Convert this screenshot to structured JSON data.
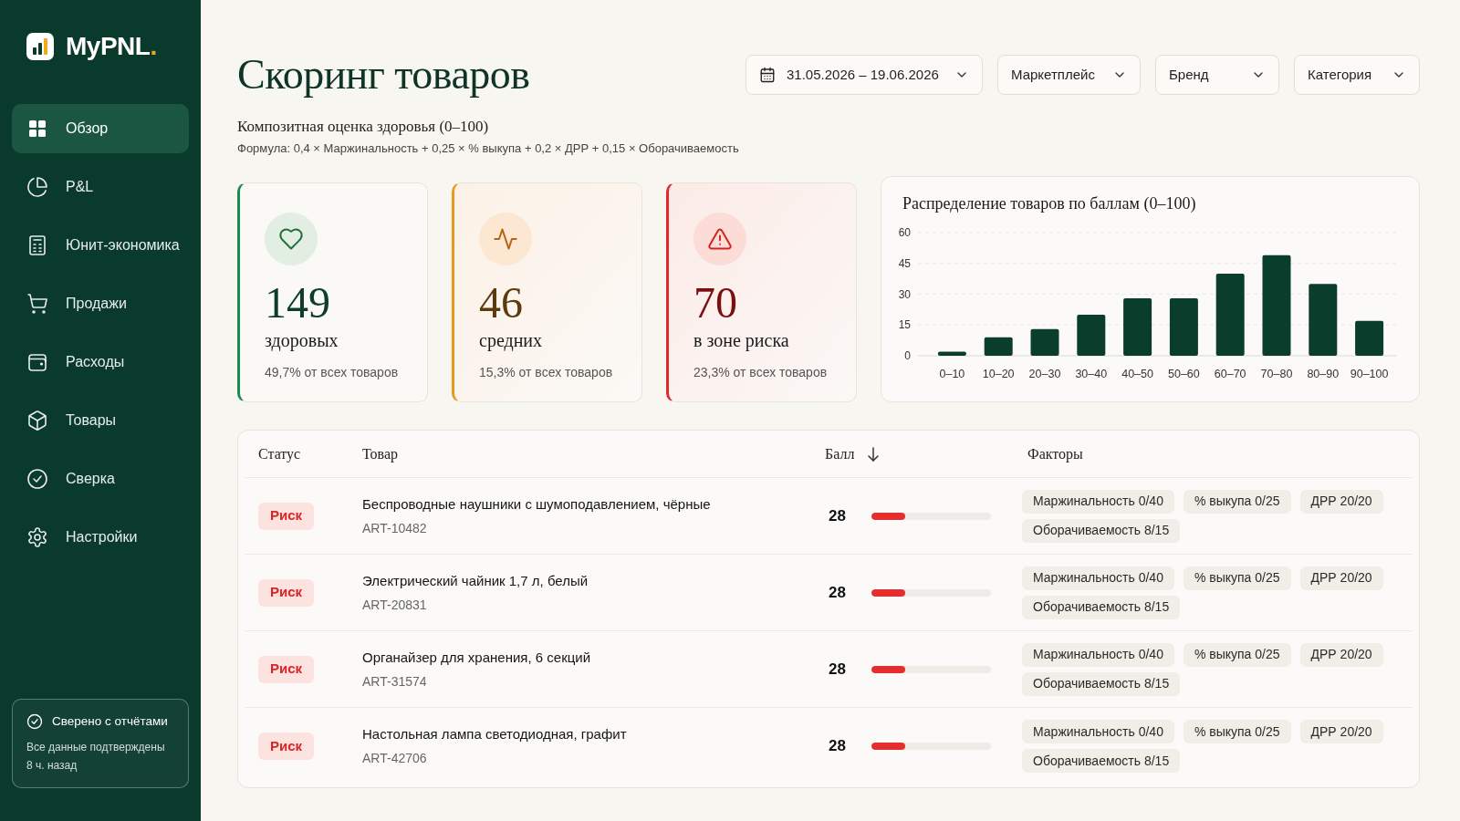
{
  "sidebar": {
    "brand": {
      "name": "MyPNL",
      "accent": "."
    },
    "items": [
      {
        "label": "Обзор",
        "selected": true
      },
      {
        "label": "P&L",
        "selected": false
      },
      {
        "label": "Юнит-экономика",
        "selected": false
      },
      {
        "label": "Продажи",
        "selected": false
      },
      {
        "label": "Расходы",
        "selected": false
      },
      {
        "label": "Товары",
        "selected": false
      },
      {
        "label": "Сверка",
        "selected": false
      },
      {
        "label": "Настройки",
        "selected": false
      }
    ],
    "sync": {
      "title": "Сверено с отчётами",
      "text": "Все данные подтверждены",
      "time": "8 ч. назад"
    }
  },
  "header": {
    "title": "Скоринг товаров",
    "filters": [
      {
        "kind": "date",
        "label": "31.05.2026 – 19.06.2026"
      },
      {
        "kind": "select",
        "label": "Маркетплейс"
      },
      {
        "kind": "select",
        "label": "Бренд"
      },
      {
        "kind": "select",
        "label": "Категория"
      }
    ],
    "subtitle": "Композитная оценка здоровья (0–100)",
    "formula": "Формула: 0,4 × Маржинальность + 0,25 × % выкупа + 0,2 × ДРР + 0,15 × Оборачиваемость"
  },
  "summary_cards": [
    {
      "kind": "healthy",
      "value": "149",
      "label": "здоровых",
      "share": "49,7% от всех товаров"
    },
    {
      "kind": "medium",
      "value": "46",
      "label": "средних",
      "share": "15,3% от всех товаров"
    },
    {
      "kind": "risk",
      "value": "70",
      "label": "в зоне риска",
      "share": "23,3% от всех товаров"
    }
  ],
  "distribution": {
    "chart_data": {
      "type": "bar",
      "title": "Распределение товаров по баллам (0–100)",
      "categories": [
        "0–10",
        "10–20",
        "20–30",
        "30–40",
        "40–50",
        "50–60",
        "60–70",
        "70–80",
        "80–90",
        "90–100"
      ],
      "values": [
        2,
        9,
        13,
        20,
        28,
        28,
        40,
        49,
        35,
        17
      ],
      "ylim": [
        0,
        60
      ],
      "yticks": [
        0,
        15,
        30,
        45,
        60
      ],
      "grid": true
    }
  },
  "table": {
    "columns": [
      {
        "label": "Статус",
        "sorted": false
      },
      {
        "label": "Товар",
        "sorted": false
      },
      {
        "label": "Балл",
        "sorted": true
      },
      {
        "label": "Факторы",
        "sorted": false
      }
    ],
    "rows": [
      {
        "status": {
          "kind": "risk",
          "label": "Риск"
        },
        "name": "Беспроводные наушники с шумоподавлением, чёрные",
        "sku": "ART-10482",
        "score": "28",
        "level": 0.28,
        "factors": [
          "Маржинальность 0/40",
          "% выкупа 0/25",
          "ДРР 20/20",
          "Оборачиваемость 8/15"
        ]
      },
      {
        "status": {
          "kind": "risk",
          "label": "Риск"
        },
        "name": "Электрический чайник 1,7 л, белый",
        "sku": "ART-20831",
        "score": "28",
        "level": 0.28,
        "factors": [
          "Маржинальность 0/40",
          "% выкупа 0/25",
          "ДРР 20/20",
          "Оборачиваемость 8/15"
        ]
      },
      {
        "status": {
          "kind": "risk",
          "label": "Риск"
        },
        "name": "Органайзер для хранения, 6 секций",
        "sku": "ART-31574",
        "score": "28",
        "level": 0.28,
        "factors": [
          "Маржинальность 0/40",
          "% выкупа 0/25",
          "ДРР 20/20",
          "Оборачиваемость 8/15"
        ]
      },
      {
        "status": {
          "kind": "risk",
          "label": "Риск"
        },
        "name": "Настольная лампа светодиодная, графит",
        "sku": "ART-42706",
        "score": "28",
        "level": 0.28,
        "factors": [
          "Маржинальность 0/40",
          "% выкупа 0/25",
          "ДРР 20/20",
          "Оборачиваемость 8/15"
        ]
      }
    ]
  }
}
